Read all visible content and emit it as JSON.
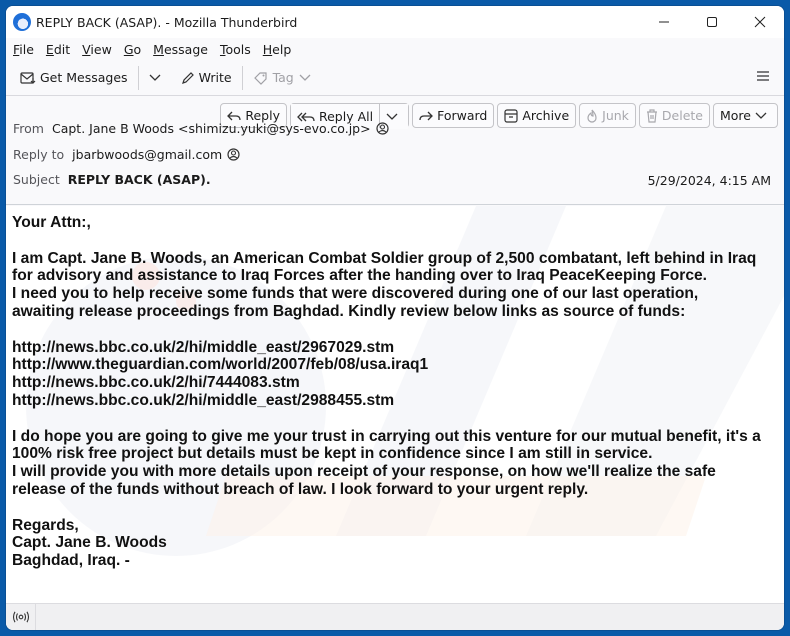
{
  "window": {
    "title": "REPLY BACK (ASAP). - Mozilla Thunderbird",
    "controls": {
      "minimize": "minimize-icon",
      "maximize": "maximize-icon",
      "close": "close-icon"
    }
  },
  "menubar": [
    {
      "label": "File",
      "accel": "F",
      "rest": "ile"
    },
    {
      "label": "Edit",
      "accel": "E",
      "rest": "dit"
    },
    {
      "label": "View",
      "accel": "V",
      "rest": "iew"
    },
    {
      "label": "Go",
      "accel": "G",
      "rest": "o"
    },
    {
      "label": "Message",
      "accel": "M",
      "rest": "essage"
    },
    {
      "label": "Tools",
      "accel": "T",
      "rest": "ools"
    },
    {
      "label": "Help",
      "accel": "H",
      "rest": "elp"
    }
  ],
  "toolbar": {
    "get_messages": "Get Messages",
    "write": "Write",
    "tag": "Tag"
  },
  "actions": {
    "reply": "Reply",
    "reply_all": "Reply All",
    "forward": "Forward",
    "archive": "Archive",
    "junk": "Junk",
    "delete": "Delete",
    "more": "More"
  },
  "header": {
    "from_label": "From",
    "from_value": "Capt. Jane B Woods <shimizu.yuki@sys-evo.co.jp>",
    "reply_to_label": "Reply to",
    "reply_to_value": "jbarbwoods@gmail.com",
    "subject_label": "Subject",
    "subject_value": "REPLY BACK (ASAP).",
    "date": "5/29/2024, 4:15 AM"
  },
  "body": {
    "greeting": "Your Attn:,",
    "para1": [
      "I am Capt. Jane B. Woods, an American Combat Soldier group of 2,500 combatant, left behind in Iraq",
      "for advisory and assistance to Iraq Forces after the handing over to Iraq PeaceKeeping Force.",
      "I need you to help receive some funds that were discovered during one of our last operation,",
      "awaiting release proceedings from Baghdad. Kindly review below links as source of funds:"
    ],
    "links": [
      "http://news.bbc.co.uk/2/hi/middle_east/2967029.stm",
      "http://www.theguardian.com/world/2007/feb/08/usa.iraq1",
      "http://news.bbc.co.uk/2/hi/7444083.stm",
      "http://news.bbc.co.uk/2/hi/middle_east/2988455.stm"
    ],
    "para2": [
      "I do hope you are going to give me your trust in carrying out this venture for our mutual benefit, it's a",
      "100% risk free project but details must be kept in confidence since I am still in service.",
      "I will provide you with more details upon receipt of your response, on how we'll realize the safe",
      "release of the funds without breach of law. I look forward to your urgent reply."
    ],
    "signature": [
      "Regards,",
      "Capt. Jane B. Woods",
      "Baghdad, Iraq. -"
    ]
  },
  "statusbar": {
    "icon": "online-status-icon"
  }
}
